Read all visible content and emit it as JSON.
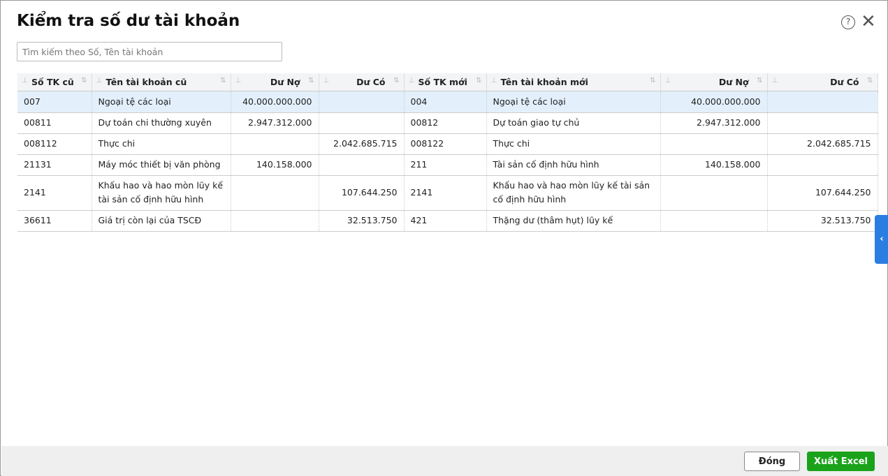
{
  "title": "Kiểm tra số dư tài khoản",
  "search": {
    "placeholder": "Tìm kiếm theo Số, Tên tài khoản"
  },
  "columns": [
    "Số TK cũ",
    "Tên tài khoản cũ",
    "Dư Nợ",
    "Dư Có",
    "Số TK mới",
    "Tên tài khoản mới",
    "Dư Nợ",
    "Dư Có"
  ],
  "rows": [
    [
      "007",
      "Ngoại tệ các loại",
      "40.000.000.000",
      "",
      "004",
      "Ngoại tệ các loại",
      "40.000.000.000",
      ""
    ],
    [
      "00811",
      "Dự toán chi thường xuyên",
      "2.947.312.000",
      "",
      "00812",
      "Dự toán giao tự chủ",
      "2.947.312.000",
      ""
    ],
    [
      "008112",
      "Thực chi",
      "",
      "2.042.685.715",
      "008122",
      "Thực chi",
      "",
      "2.042.685.715"
    ],
    [
      "21131",
      "Máy móc thiết bị văn phòng",
      "140.158.000",
      "",
      "211",
      "Tài sản cố định hữu hình",
      "140.158.000",
      ""
    ],
    [
      "2141",
      "Khấu hao và hao mòn lũy kế tài sản cố định hữu hình",
      "",
      "107.644.250",
      "2141",
      "Khấu hao và hao mòn lũy kế tài sản cố định hữu hình",
      "",
      "107.644.250"
    ],
    [
      "36611",
      "Giá trị còn lại của TSCĐ",
      "",
      "32.513.750",
      "421",
      "Thặng dư (thâm hụt) lũy kế",
      "",
      "32.513.750"
    ]
  ],
  "buttons": {
    "close": "Đóng",
    "export": "Xuất Excel"
  },
  "help_label": "?"
}
